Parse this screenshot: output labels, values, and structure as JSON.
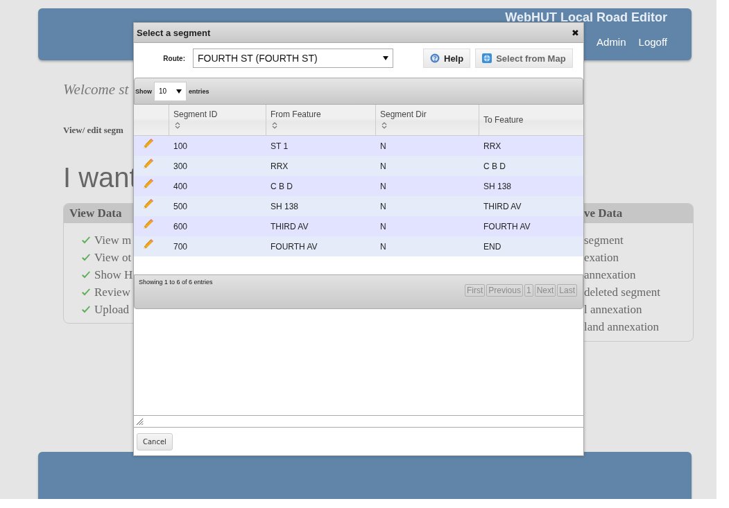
{
  "header": {
    "title": "WebHUT Local Road Editor",
    "nav": [
      "Admin",
      "Logoff"
    ]
  },
  "page": {
    "welcome": "Welcome st",
    "edit_link": "View/ edit segm",
    "heading": "I want"
  },
  "panels": [
    {
      "title": "View Data",
      "items": [
        "View m",
        "View ot",
        "Show H",
        "Review",
        "Upload"
      ]
    },
    {
      "title": "ve Data",
      "items": [
        "segment",
        "exation",
        "annexation",
        "deleted segment",
        "l annexation",
        "land annexation"
      ]
    }
  ],
  "dialog": {
    "title": "Select a segment",
    "close": "✖",
    "route_label": "Route:",
    "route_value": "FOURTH ST (FOURTH ST)",
    "help_button": "Help",
    "map_button": "Select from Map",
    "length": {
      "show": "Show",
      "value": "10",
      "entries": "entries"
    },
    "columns": [
      {
        "label": "Segment ID",
        "sortable": true
      },
      {
        "label": "From Feature",
        "sortable": true
      },
      {
        "label": "Segment Dir",
        "sortable": true
      },
      {
        "label": "To Feature",
        "sortable": false
      }
    ],
    "rows": [
      {
        "cells": [
          "100",
          "ST 1",
          "N",
          "RRX"
        ]
      },
      {
        "cells": [
          "300",
          "RRX",
          "N",
          "C B D"
        ]
      },
      {
        "cells": [
          "400",
          "C B D",
          "N",
          "SH 138"
        ]
      },
      {
        "cells": [
          "500",
          "SH 138",
          "N",
          "THIRD AV"
        ]
      },
      {
        "cells": [
          "600",
          "THIRD AV",
          "N",
          "FOURTH AV"
        ]
      },
      {
        "cells": [
          "700",
          "FOURTH AV",
          "N",
          "END"
        ]
      }
    ],
    "info": "Showing 1 to 6 of 6 entries",
    "pager": [
      {
        "label": "First",
        "disabled": true
      },
      {
        "label": "Previous",
        "disabled": true
      },
      {
        "label": "1",
        "disabled": true
      },
      {
        "label": "Next",
        "disabled": true
      },
      {
        "label": "Last",
        "disabled": true
      }
    ],
    "cancel_button": "Cancel"
  }
}
